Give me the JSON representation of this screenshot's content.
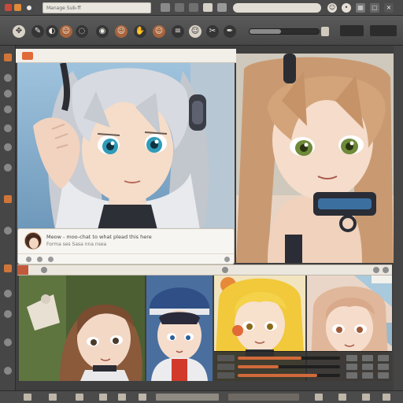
{
  "window": {
    "title_field": "Manage Sub-ff",
    "address_field": "",
    "colors": {
      "accent": "#d0753a",
      "chrome": "#4a4a4a",
      "panel": "#f2efe9"
    }
  },
  "top_right_icons": [
    "user-icon",
    "bell-icon",
    "grid-icon",
    "window-icon",
    "close-icon"
  ],
  "toolbar": {
    "tools": [
      "move-icon",
      "brush-icon",
      "eraser-icon",
      "character-icon",
      "lasso-icon",
      "fill-icon",
      "select-icon",
      "hand-icon",
      "crop-icon",
      "layers-icon",
      "face-icon",
      "hair-icon",
      "pen-icon",
      "cursor-icon",
      "eye-icon",
      "star-icon"
    ],
    "brush_size_fraction": 0.46
  },
  "left_rail_icons": [
    "tool-a-icon",
    "tool-b-icon",
    "tool-c-icon",
    "tool-d-icon",
    "tool-e-icon",
    "tool-f-icon",
    "tool-g-icon",
    "tool-h-icon",
    "tool-i-icon",
    "tool-j-icon",
    "tool-k-icon",
    "tool-l-icon",
    "tool-m-icon",
    "tool-n-icon"
  ],
  "header": {
    "title": ""
  },
  "comment": {
    "name": "Meow - moo-chat to what plead this here",
    "text": "Forma ses Sasa nna nsea",
    "stats": "",
    "actions": [
      "like-icon",
      "reply-icon",
      "share-icon"
    ]
  },
  "mid_strip": {
    "label": ""
  },
  "gallery": {
    "thumbnails": [
      {
        "name": "brown-haired-girl-thumb"
      },
      {
        "name": "blue-cap-boy-thumb"
      },
      {
        "name": "blonde-girl-thumb"
      },
      {
        "name": "pink-tone-girl-thumb"
      }
    ]
  },
  "layer_panel": {
    "opacity_fraction": 0.62,
    "blend_fraction": 0.4,
    "fill_fraction": 0.78
  },
  "statusbar": {
    "zoom": ""
  }
}
